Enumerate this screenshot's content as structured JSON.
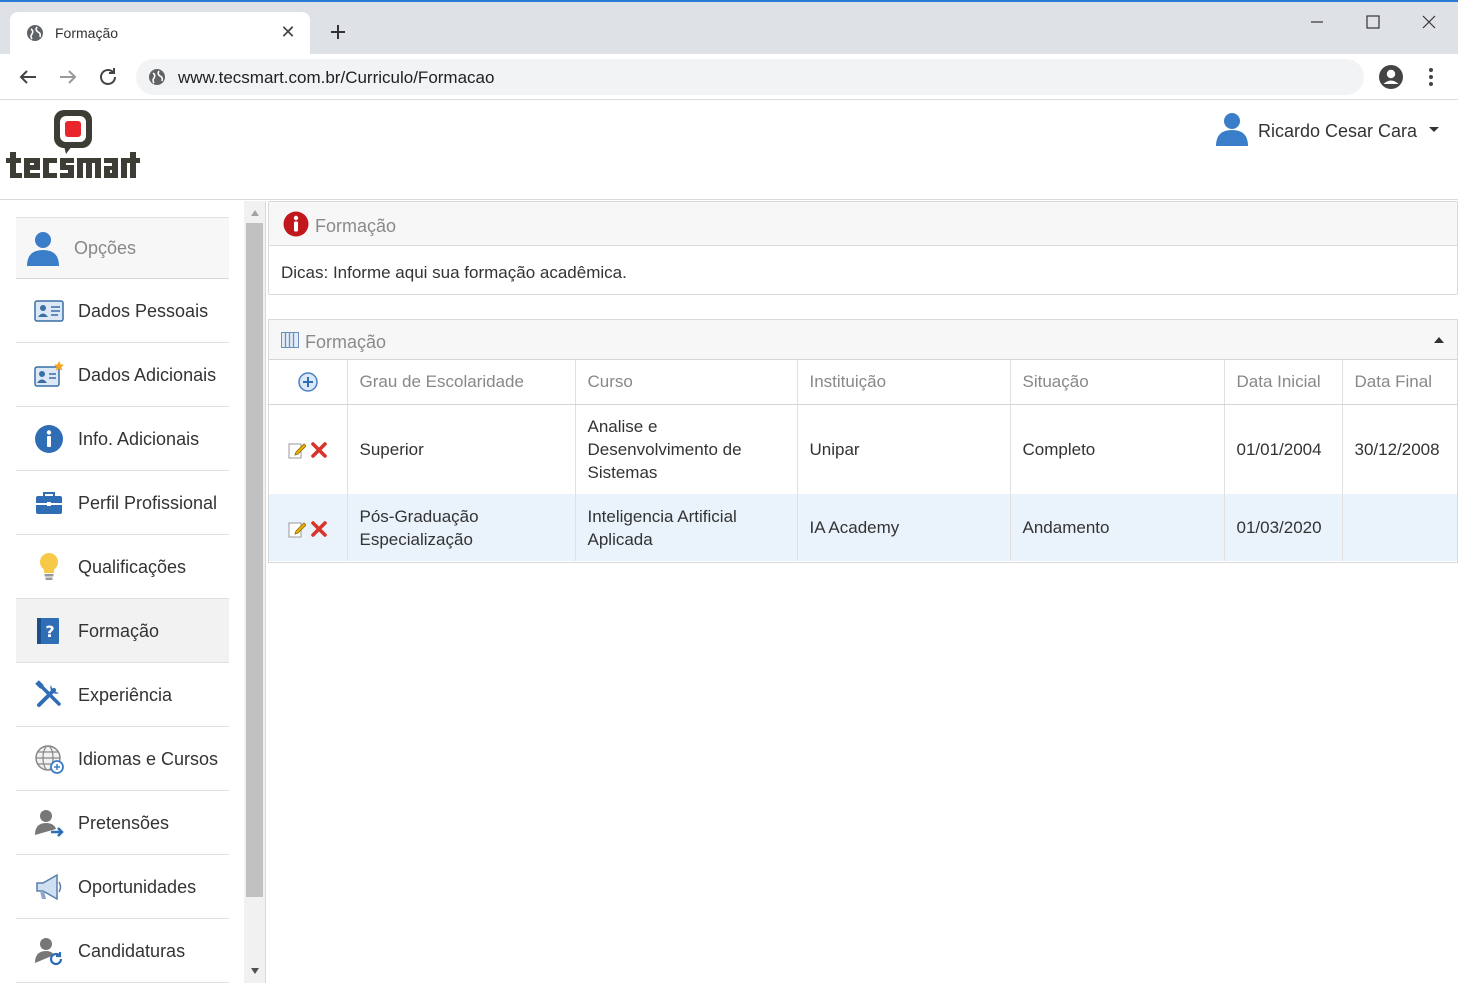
{
  "browser": {
    "tab_title": "Formação",
    "url": "www.tecsmart.com.br/Curriculo/Formacao"
  },
  "header": {
    "user_name": "Ricardo Cesar Cara",
    "logo_text": "tecsmart"
  },
  "sidebar": {
    "header_label": "Opções",
    "items": [
      {
        "label": "Dados Pessoais",
        "icon": "id-card-icon"
      },
      {
        "label": "Dados Adicionais",
        "icon": "id-card-star-icon"
      },
      {
        "label": "Info. Adicionais",
        "icon": "info-circle-icon"
      },
      {
        "label": "Perfil Profissional",
        "icon": "briefcase-icon"
      },
      {
        "label": "Qualificações",
        "icon": "lightbulb-icon"
      },
      {
        "label": "Formação",
        "icon": "book-question-icon",
        "active": true
      },
      {
        "label": "Experiência",
        "icon": "tools-icon"
      },
      {
        "label": "Idiomas e Cursos",
        "icon": "globe-icon"
      },
      {
        "label": "Pretensões",
        "icon": "user-arrow-icon"
      },
      {
        "label": "Oportunidades",
        "icon": "megaphone-icon"
      },
      {
        "label": "Candidaturas",
        "icon": "user-refresh-icon"
      }
    ]
  },
  "info_panel": {
    "title": "Formação",
    "tip": "Dicas: Informe aqui sua formação acadêmica."
  },
  "grid": {
    "title": "Formação",
    "columns": [
      "Grau de Escolaridade",
      "Curso",
      "Instituição",
      "Situação",
      "Data Inicial",
      "Data Final"
    ],
    "rows": [
      {
        "grau": "Superior",
        "curso": "Analise e Desenvolvimento de Sistemas",
        "instituicao": "Unipar",
        "situacao": "Completo",
        "data_inicial": "01/01/2004",
        "data_final": "30/12/2008"
      },
      {
        "grau": "Pós-Graduação Especialização",
        "curso": "Inteligencia Artificial Aplicada",
        "instituicao": "IA Academy",
        "situacao": "Andamento",
        "data_inicial": "01/03/2020",
        "data_final": ""
      }
    ]
  },
  "colors": {
    "accent_blue": "#3a7dc9",
    "logo_red": "#e8262b",
    "logo_dark": "#3d3d35",
    "delete_red": "#d9342b",
    "selected_row": "#eaf3fc"
  }
}
